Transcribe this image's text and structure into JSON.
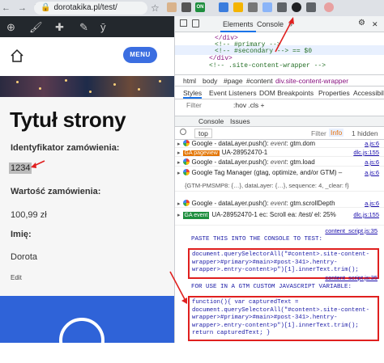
{
  "browser": {
    "nav_icons": "← → ↻",
    "url": "dorotakika.pl/test/",
    "lock_icon": "🔒",
    "star_icon": "☆",
    "extensions": [
      {
        "name": "tag-assistant-icon",
        "color": "#3b7ddd"
      },
      {
        "name": "analytics-icon",
        "color": "#f4b400"
      },
      {
        "name": "adblock-icon",
        "color": "#555"
      },
      {
        "name": "extension-icon",
        "color": "#5f6368"
      },
      {
        "name": "extension-icon",
        "color": "#8ab4f8"
      }
    ],
    "ext_on_badge": "ON"
  },
  "website": {
    "wp_icons": [
      "⊕",
      "🖌",
      "✚",
      "✎",
      "ȳ"
    ],
    "menu_label": "MENU",
    "title": "Tytuł strony",
    "order_id_label": "Identyfikator zamówienia:",
    "order_id_value": "1234",
    "order_value_label": "Wartość zamówienia:",
    "order_value": "100,99 zł",
    "name_label": "Imię:",
    "name_value": "Dorota",
    "edit_link": "Edit"
  },
  "devtools": {
    "tabs": {
      "elements": "Elements",
      "console": "Console"
    },
    "more": "»",
    "settings_icon": "⚙",
    "close_icon": "✕",
    "dom_lines": [
      "</div>",
      "<!-- #primary -->",
      "<!-- #secondary --> == $0",
      "</div>",
      "<!-- .site-content-wrapper -->"
    ],
    "breadcrumbs": [
      "html",
      "body",
      "#page",
      "#content",
      "div.site-content-wrapper"
    ],
    "style_tabs": [
      "Styles",
      "Event Listeners",
      "DOM Breakpoints",
      "Properties",
      "Accessibility"
    ],
    "filter_placeholder": "Filter",
    "filter_buttons": ":hov  .cls  +",
    "drawer_tabs": [
      "Console",
      "Issues"
    ],
    "console_context": "top",
    "console_filter": "Filter",
    "console_level": "Info",
    "hidden_count": "1 hidden",
    "console_rows": [
      {
        "type": "google",
        "text": "Google - dataLayer.push():",
        "event": "event",
        "name": "gtm.dom",
        "src": "a.js:6"
      },
      {
        "type": "ga",
        "badge": "GA pageview",
        "text": "UA-28952470-1",
        "src": "dlc.js:155"
      },
      {
        "type": "google",
        "text": "Google - dataLayer.push():",
        "event": "event",
        "name": "gtm.load",
        "src": "a.js:6"
      },
      {
        "type": "google",
        "text": "Google Tag Manager (gtag, optimize, and/or GTM) –",
        "src": "a.js:6"
      },
      {
        "type": "obj",
        "text": "{GTM-PMSMP8: {…}, dataLayer: {…}, sequence: 4, _clear: f}"
      },
      {
        "type": "google",
        "text": "Google - dataLayer.push():",
        "event": "event",
        "name": "gtm.scrollDepth",
        "src": "a.js:6"
      },
      {
        "type": "ga",
        "badge": "GA event",
        "text": "UA-28952470-1  ec: Scroll  ea: /test/  el: 25%",
        "src": "dlc.js:155"
      }
    ],
    "content_script_src": "content_script.js:35",
    "paste_heading": "PASTE THIS INTO THE CONSOLE TO TEST:",
    "code1": "document.querySelectorAll(\"#content>.site-content-wrapper>#primary>#main>#post-341>.hentry-wrapper>.entry-content>p\")[1].innerText.trim();",
    "gtm_heading": "FOR USE IN A GTM CUSTOM JAVASCRIPT VARIABLE:",
    "code2": "function(){ var capturedText = document.querySelectorAll(\"#content>.site-content-wrapper>#primary>#main>#post-341>.hentry-wrapper>.entry-content>p\")[1].innerText.trim(); return capturedText; }"
  }
}
